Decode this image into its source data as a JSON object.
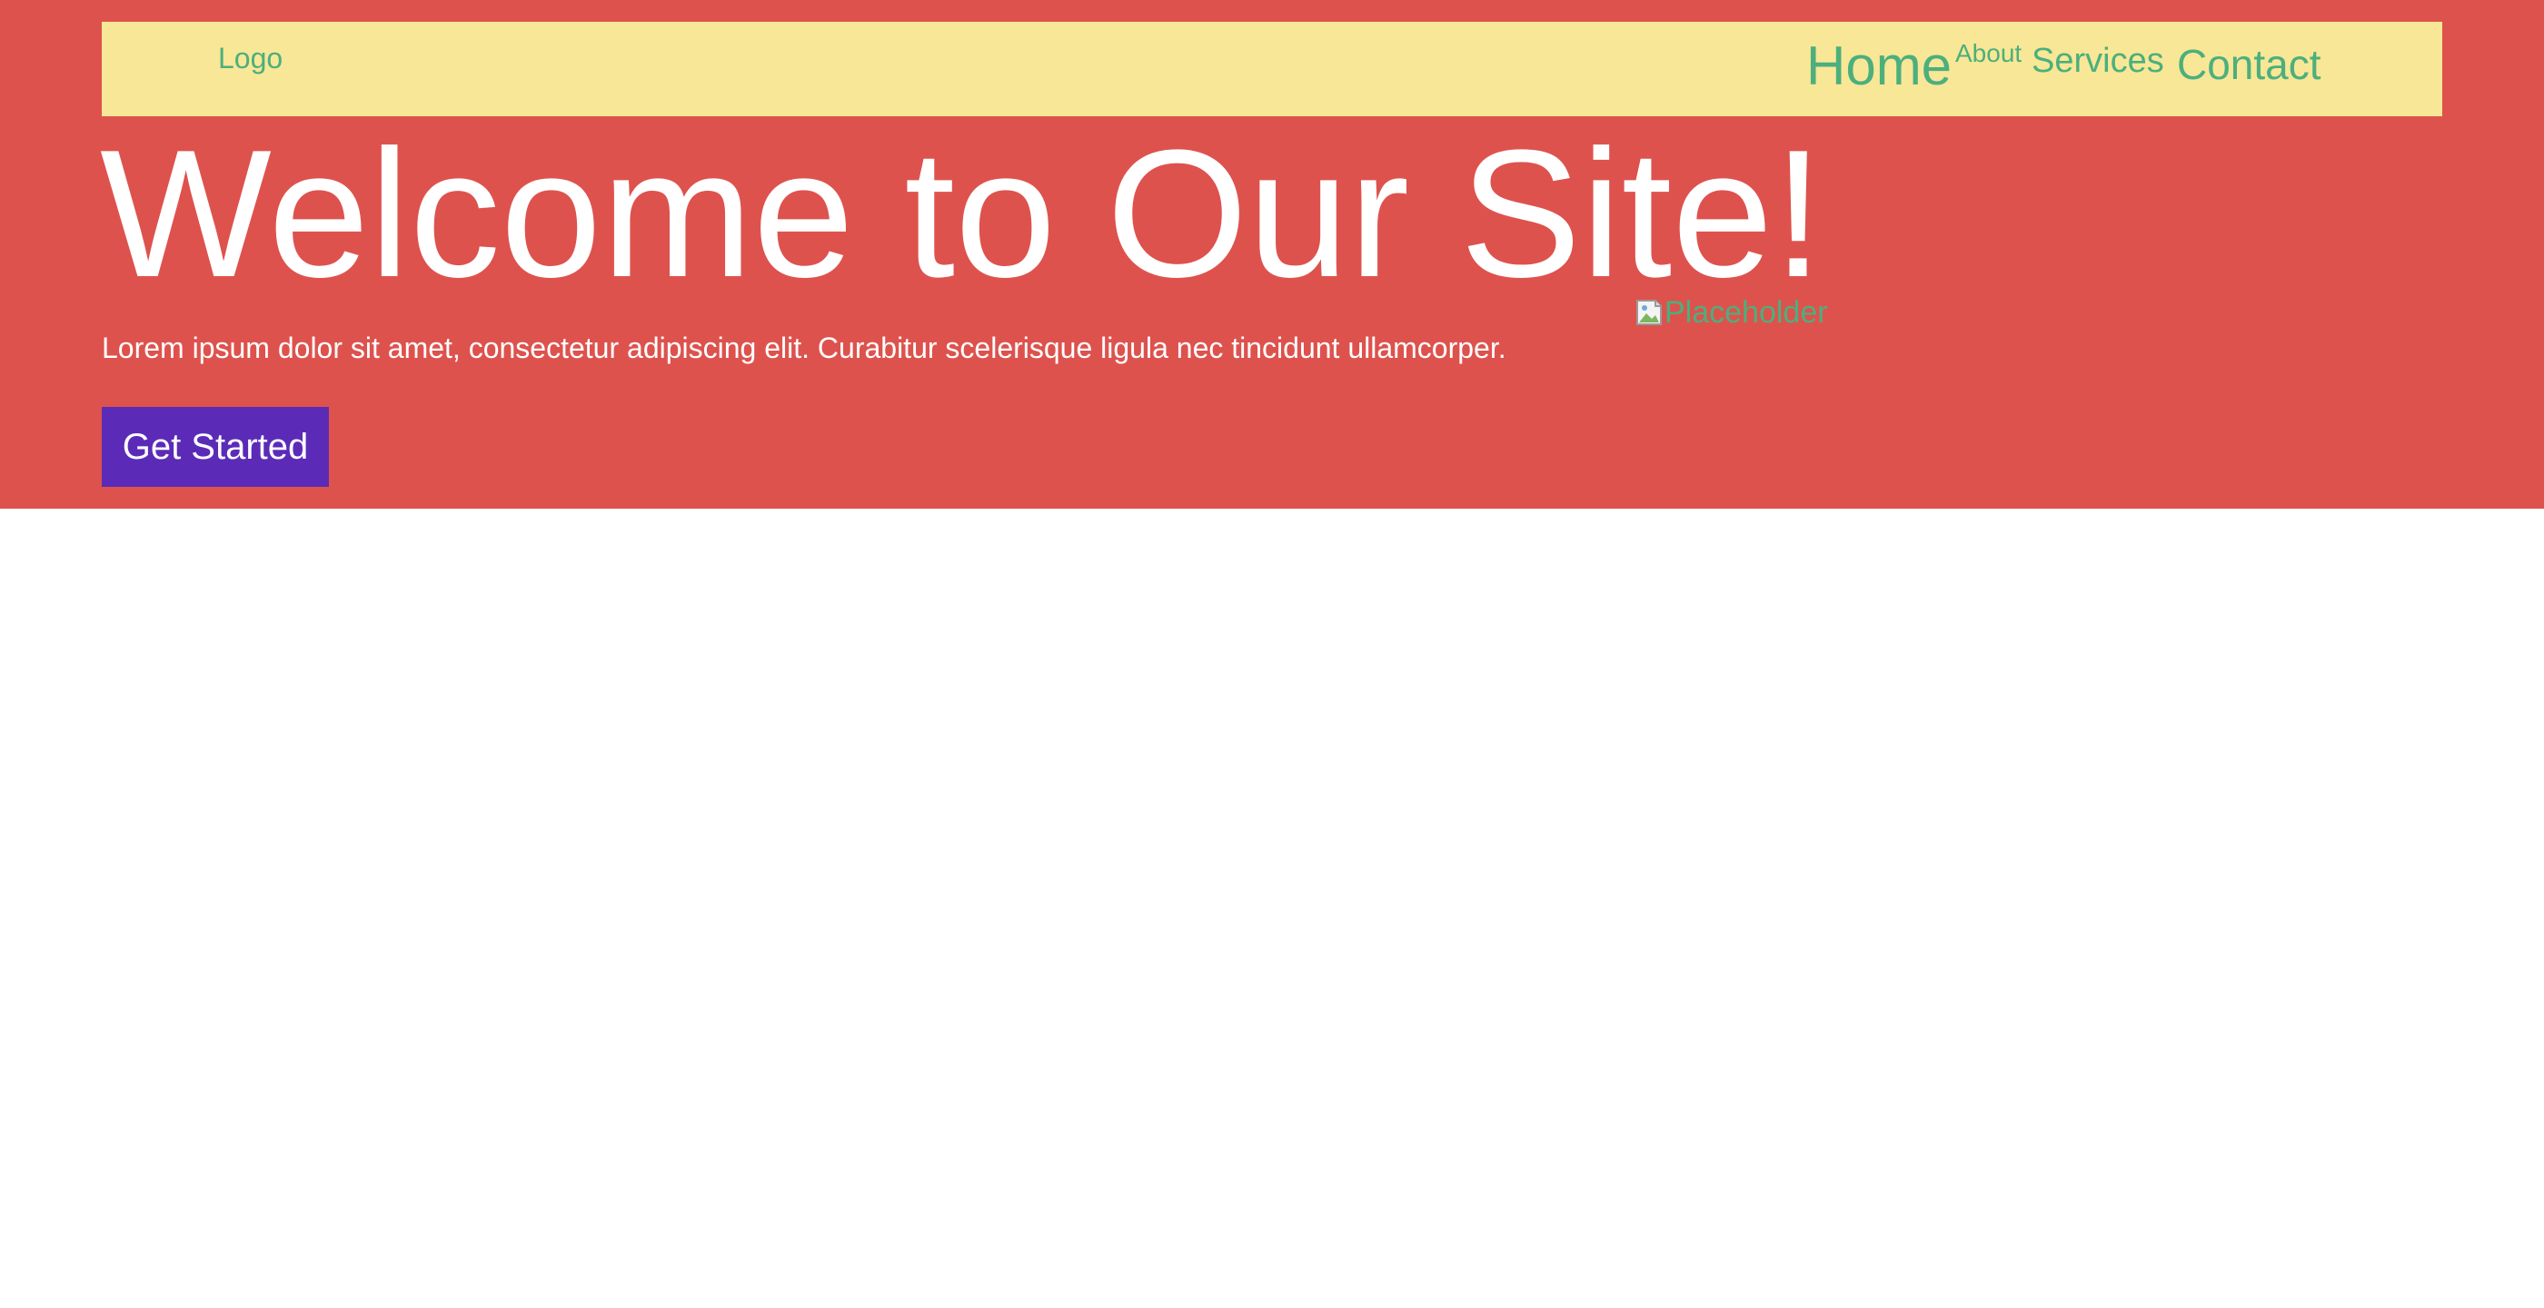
{
  "navbar": {
    "logo": "Logo",
    "links": [
      {
        "label": "Home"
      },
      {
        "label": "About"
      },
      {
        "label": "Services"
      },
      {
        "label": "Contact"
      }
    ]
  },
  "hero": {
    "title": "Welcome to Our Site!",
    "text": "Lorem ipsum dolor sit amet, consectetur adipiscing elit. Curabitur scelerisque ligula nec tincidunt ullamcorper.",
    "image_alt": "Placeholder",
    "image_icon": "broken-image-icon",
    "cta_label": "Get Started"
  },
  "colors": {
    "hero_background": "#de524d",
    "navbar_background": "#f8e796",
    "link_color": "#4caf7d",
    "button_background": "#5b2bb8",
    "text_light": "#ffffff"
  }
}
